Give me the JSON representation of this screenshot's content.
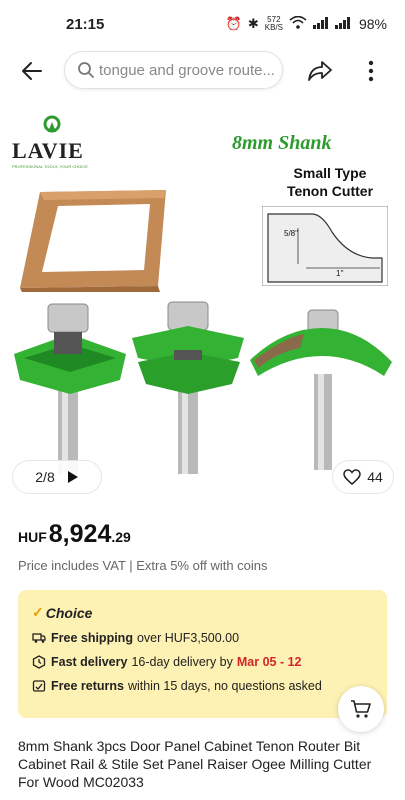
{
  "status_bar": {
    "time": "21:15",
    "network_speed_value": "572",
    "network_speed_unit": "KB/S",
    "battery": "98%"
  },
  "header": {
    "search_placeholder": "tongue and groove route..."
  },
  "gallery": {
    "brand": "LAVIE",
    "brand_tagline": "PROFESSIONAL TOOLS, YOUR CHOICE",
    "shank_title": "8mm Shank",
    "type_title_1": "Small Type",
    "type_title_2": "Tenon Cutter",
    "dimension_1": "5/8''",
    "dimension_2": "1''",
    "page_indicator": "2/8",
    "likes": "44"
  },
  "price": {
    "currency": "HUF",
    "integer": "8,924",
    "decimal": ".29",
    "vat_note": "Price includes VAT | Extra 5% off with coins"
  },
  "choice": {
    "label": "Choice",
    "shipping_bold": "Free shipping",
    "shipping_text": "over HUF3,500.00",
    "delivery_bold": "Fast delivery",
    "delivery_text": "16-day delivery by",
    "delivery_date": "Mar 05 - 12",
    "returns_bold": "Free returns",
    "returns_text": "within 15 days, no questions asked"
  },
  "product": {
    "title": "8mm Shank 3pcs Door Panel Cabinet Tenon Router Bit Cabinet Rail & Stile Set Panel Raiser Ogee Milling Cutter For Wood MC02033"
  },
  "colors": {
    "accent_red": "#d3262a",
    "choice_bg": "#fdf1b3",
    "cutter_green": "#34b233"
  }
}
